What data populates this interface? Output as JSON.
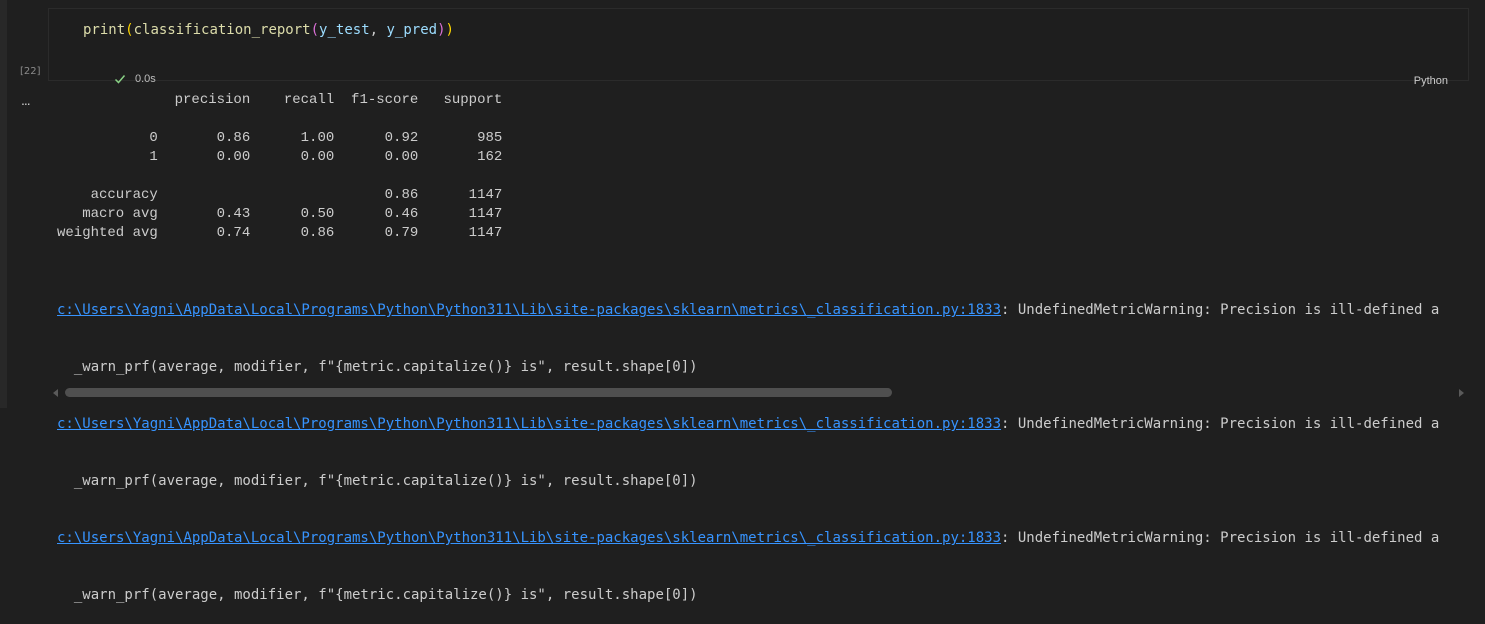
{
  "cell": {
    "code": {
      "fn_outer": "print",
      "fn_inner": "classification_report",
      "arg1": "y_test",
      "arg2": "y_pred"
    },
    "exec_count": "[22]",
    "duration": "0.0s",
    "language": "Python"
  },
  "output": {
    "more_label": "...",
    "report_text": "              precision    recall  f1-score   support\n\n           0       0.86      1.00      0.92       985\n           1       0.00      0.00      0.00       162\n\n    accuracy                           0.86      1147\n   macro avg       0.43      0.50      0.46      1147\nweighted avg       0.74      0.86      0.79      1147",
    "report": {
      "columns": [
        "precision",
        "recall",
        "f1-score",
        "support"
      ],
      "rows": [
        {
          "label": "0",
          "precision": "0.86",
          "recall": "1.00",
          "f1-score": "0.92",
          "support": "985"
        },
        {
          "label": "1",
          "precision": "0.00",
          "recall": "0.00",
          "f1-score": "0.00",
          "support": "162"
        },
        {
          "label": "accuracy",
          "precision": "",
          "recall": "",
          "f1-score": "0.86",
          "support": "1147"
        },
        {
          "label": "macro avg",
          "precision": "0.43",
          "recall": "0.50",
          "f1-score": "0.46",
          "support": "1147"
        },
        {
          "label": "weighted avg",
          "precision": "0.74",
          "recall": "0.86",
          "f1-score": "0.79",
          "support": "1147"
        }
      ]
    },
    "warnings": [
      {
        "link": "c:\\Users\\Yagni\\AppData\\Local\\Programs\\Python\\Python311\\Lib\\site-packages\\sklearn\\metrics\\_classification.py:1833",
        "message": ": UndefinedMetricWarning: Precision is ill-defined a",
        "code": "  _warn_prf(average, modifier, f\"{metric.capitalize()} is\", result.shape[0])"
      },
      {
        "link": "c:\\Users\\Yagni\\AppData\\Local\\Programs\\Python\\Python311\\Lib\\site-packages\\sklearn\\metrics\\_classification.py:1833",
        "message": ": UndefinedMetricWarning: Precision is ill-defined a",
        "code": "  _warn_prf(average, modifier, f\"{metric.capitalize()} is\", result.shape[0])"
      },
      {
        "link": "c:\\Users\\Yagni\\AppData\\Local\\Programs\\Python\\Python311\\Lib\\site-packages\\sklearn\\metrics\\_classification.py:1833",
        "message": ": UndefinedMetricWarning: Precision is ill-defined a",
        "code": "  _warn_prf(average, modifier, f\"{metric.capitalize()} is\", result.shape[0])"
      }
    ]
  },
  "colors": {
    "background": "#1f1f1f",
    "link": "#3794ff",
    "success_check": "#89d185"
  }
}
